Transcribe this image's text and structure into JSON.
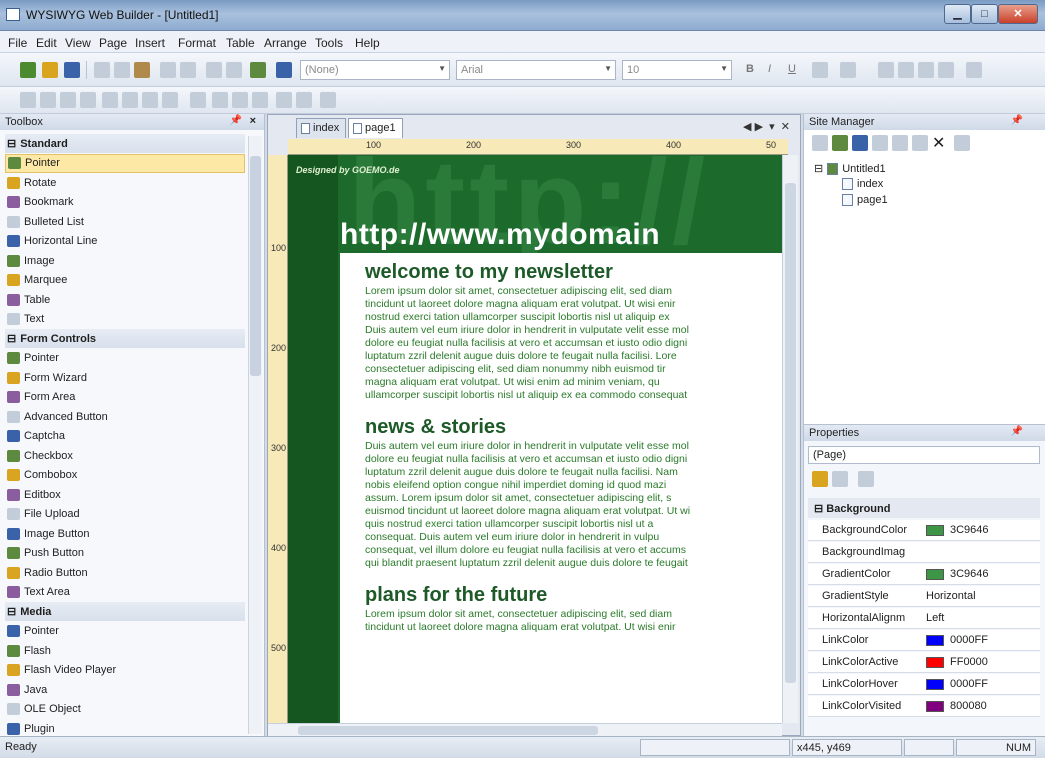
{
  "window": {
    "title": "WYSIWYG Web Builder - [Untitled1]"
  },
  "menu": [
    "File",
    "Edit",
    "View",
    "Page",
    "Insert",
    "Format",
    "Table",
    "Arrange",
    "Tools",
    "Help"
  ],
  "toolbar": {
    "style_combo": "(None)",
    "font_combo": "Arial",
    "size_combo": "10",
    "format_buttons": [
      "B",
      "I",
      "U"
    ]
  },
  "toolbox": {
    "title": "Toolbox",
    "items": [
      {
        "label": "Standard",
        "group": true
      },
      {
        "label": "Pointer",
        "selected": true,
        "icon": "pointer-icon"
      },
      {
        "label": "Rotate",
        "icon": "rotate-icon"
      },
      {
        "label": "Bookmark",
        "icon": "bookmark-icon"
      },
      {
        "label": "Bulleted List",
        "icon": "list-icon"
      },
      {
        "label": "Horizontal Line",
        "icon": "line-icon"
      },
      {
        "label": "Image",
        "icon": "image-icon"
      },
      {
        "label": "Marquee",
        "icon": "marquee-icon"
      },
      {
        "label": "Table",
        "icon": "table-icon"
      },
      {
        "label": "Text",
        "icon": "text-icon"
      },
      {
        "label": "Form Controls",
        "group": true
      },
      {
        "label": "Pointer",
        "icon": "pointer-icon"
      },
      {
        "label": "Form Wizard",
        "icon": "wizard-icon"
      },
      {
        "label": "Form Area",
        "icon": "form-area-icon"
      },
      {
        "label": "Advanced Button",
        "icon": "button-icon"
      },
      {
        "label": "Captcha",
        "icon": "captcha-icon"
      },
      {
        "label": "Checkbox",
        "icon": "checkbox-icon"
      },
      {
        "label": "Combobox",
        "icon": "combobox-icon"
      },
      {
        "label": "Editbox",
        "icon": "editbox-icon"
      },
      {
        "label": "File Upload",
        "icon": "upload-icon"
      },
      {
        "label": "Image Button",
        "icon": "image-button-icon"
      },
      {
        "label": "Push Button",
        "icon": "push-button-icon"
      },
      {
        "label": "Radio Button",
        "icon": "radio-icon"
      },
      {
        "label": "Text Area",
        "icon": "textarea-icon"
      },
      {
        "label": "Media",
        "group": true
      },
      {
        "label": "Pointer",
        "icon": "pointer-icon"
      },
      {
        "label": "Flash",
        "icon": "flash-icon"
      },
      {
        "label": "Flash Video Player",
        "icon": "video-icon"
      },
      {
        "label": "Java",
        "icon": "java-icon"
      },
      {
        "label": "OLE Object",
        "icon": "ole-icon"
      },
      {
        "label": "Plugin",
        "icon": "plugin-icon"
      }
    ]
  },
  "editor": {
    "tabs": [
      "index",
      "page1"
    ],
    "ruler_top": [
      "100",
      "200",
      "300",
      "400",
      "50"
    ],
    "ruler_left": [
      "100",
      "200",
      "300",
      "400",
      "500"
    ],
    "page": {
      "designed_by": "Designed by GOEMO.de",
      "watermark": "http://",
      "domain": "http://www.mydomain",
      "sections": [
        {
          "heading": "welcome to my newsletter",
          "lines": [
            "Lorem ipsum dolor sit amet, consectetuer adipiscing elit, sed diam",
            "tincidunt ut laoreet dolore magna aliquam erat volutpat. Ut wisi enir",
            "nostrud exerci tation ullamcorper suscipit lobortis nisl ut aliquip ex",
            "Duis autem vel eum iriure dolor in hendrerit in vulputate velit esse mol",
            "dolore eu feugiat nulla facilisis at vero et accumsan et iusto odio digni",
            "luptatum zzril delenit augue duis dolore te feugait nulla facilisi. Lore",
            "consectetuer adipiscing elit, sed diam nonummy nibh euismod tir",
            "magna aliquam erat volutpat. Ut wisi enim ad minim veniam, qu",
            "ullamcorper suscipit lobortis nisl ut aliquip ex ea commodo consequat"
          ]
        },
        {
          "heading": "news & stories",
          "lines": [
            "Duis autem vel eum iriure dolor in hendrerit in vulputate velit esse mol",
            "dolore eu feugiat nulla facilisis at vero et accumsan et iusto odio digni",
            "luptatum zzril delenit augue duis dolore te feugait nulla facilisi. Nam",
            "nobis eleifend option congue nihil imperdiet doming id quod mazi",
            "assum. Lorem ipsum dolor sit amet, consectetuer adipiscing elit, s",
            "euismod tincidunt ut laoreet dolore magna aliquam erat volutpat. Ut wi",
            "quis nostrud exerci tation ullamcorper suscipit lobortis nisl ut a",
            "consequat. Duis autem vel eum iriure dolor in hendrerit in vulpu",
            "consequat, vel illum dolore eu feugiat nulla facilisis at vero et accums",
            "qui blandit praesent luptatum zzril delenit augue duis dolore te feugait"
          ]
        },
        {
          "heading": "plans for the future",
          "lines": [
            "Lorem ipsum dolor sit amet, consectetuer adipiscing elit, sed diam",
            "tincidunt ut laoreet dolore magna aliquam erat volutpat. Ut wisi enir"
          ]
        }
      ]
    }
  },
  "site_manager": {
    "title": "Site Manager",
    "tree": {
      "root": "Untitled1",
      "children": [
        "index",
        "page1"
      ]
    }
  },
  "properties": {
    "title": "Properties",
    "object": "(Page)",
    "category": "Background",
    "rows": [
      {
        "name": "BackgroundColor",
        "value": "3C9646",
        "color": "#3C9646"
      },
      {
        "name": "BackgroundImag",
        "value": ""
      },
      {
        "name": "GradientColor",
        "value": "3C9646",
        "color": "#3C9646"
      },
      {
        "name": "GradientStyle",
        "value": "Horizontal"
      },
      {
        "name": "HorizontalAlignm",
        "value": "Left"
      },
      {
        "name": "LinkColor",
        "value": "0000FF",
        "color": "#0000FF"
      },
      {
        "name": "LinkColorActive",
        "value": "FF0000",
        "color": "#FF0000"
      },
      {
        "name": "LinkColorHover",
        "value": "0000FF",
        "color": "#0000FF"
      },
      {
        "name": "LinkColorVisited",
        "value": "800080",
        "color": "#800080"
      }
    ]
  },
  "status": {
    "text": "Ready",
    "coords": "x445, y469",
    "num": "NUM"
  }
}
